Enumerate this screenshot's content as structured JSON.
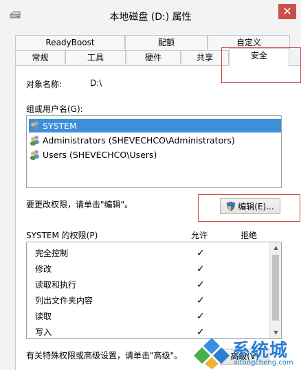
{
  "window": {
    "title": "本地磁盘 (D:) 属性",
    "close_label": "✕"
  },
  "tabs_top": [
    "ReadyBoost",
    "配额",
    "自定义"
  ],
  "tabs_bottom": [
    "常规",
    "工具",
    "硬件",
    "共享",
    "安全"
  ],
  "object": {
    "label": "对象名称:",
    "value": "D:\\"
  },
  "groups": {
    "label": "组或用户名(G):",
    "items": [
      {
        "name": "SYSTEM",
        "selected": true
      },
      {
        "name": "Administrators (SHEVECHCO\\Administrators)",
        "selected": false
      },
      {
        "name": "Users (SHEVECHCO\\Users)",
        "selected": false
      }
    ]
  },
  "change_text": "要更改权限，请单击\"编辑\"。",
  "edit_button": "编辑(E)...",
  "permissions": {
    "title": "SYSTEM 的权限(P)",
    "allow_header": "允许",
    "deny_header": "拒绝",
    "items": [
      {
        "name": "完全控制",
        "allow": "✓"
      },
      {
        "name": "修改",
        "allow": "✓"
      },
      {
        "name": "读取和执行",
        "allow": "✓"
      },
      {
        "name": "列出文件夹内容",
        "allow": "✓"
      },
      {
        "name": "读取",
        "allow": "✓"
      },
      {
        "name": "写入",
        "allow": "✓"
      }
    ]
  },
  "footer_text": "有关特殊权限或高级设置，请单击\"高级\"。",
  "advanced_button": "高级(V)",
  "watermark": {
    "title": "系统城",
    "subtitle": "xitongcheng.com"
  },
  "colors": {
    "selection": "#3e8fdb",
    "close": "#c8504a",
    "highlight_box": "#d04040",
    "watermark": "#2a7fd0"
  }
}
